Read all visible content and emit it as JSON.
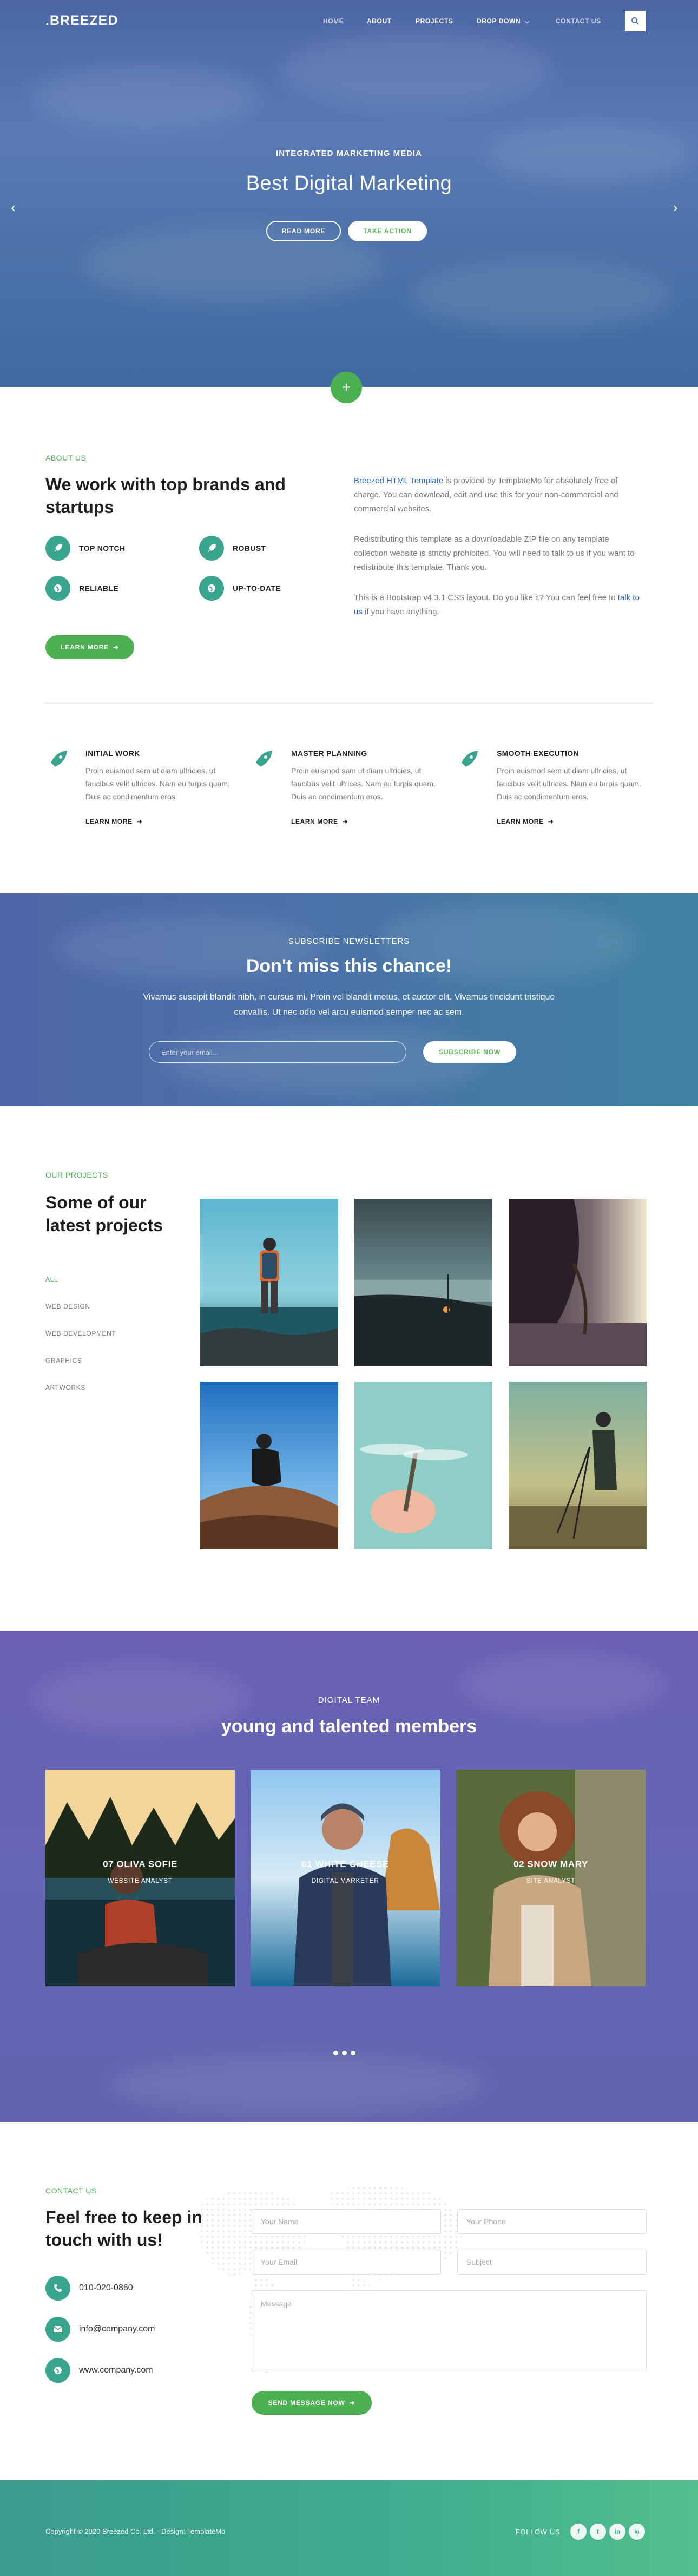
{
  "header": {
    "brand": ".BREEZED",
    "nav": [
      "HOME",
      "ABOUT",
      "PROJECTS",
      "DROP DOWN",
      "CONTACT US"
    ]
  },
  "hero": {
    "subtitle": "INTEGRATED MARKETING MEDIA",
    "title": "Best Digital Marketing",
    "read_more": "READ MORE",
    "take_action": "TAKE ACTION"
  },
  "about": {
    "label": "ABOUT US",
    "title": "We work with top brands and startups",
    "features": [
      "TOP NOTCH",
      "ROBUST",
      "RELIABLE",
      "UP-TO-DATE"
    ],
    "learn_more": "LEARN MORE",
    "p1_link": "Breezed HTML Template",
    "p1_text": " is provided by TemplateMo for absolutely free of charge. You can download, edit and use this for your non-commercial and commercial websites.",
    "p2": "Redistributing this template as a downloadable ZIP file on any template collection website is strictly prohibited. You will need to talk to us if you want to redistribute this template. Thank you.",
    "p3_text": "This is a Bootstrap v4.3.1 CSS layout. Do you like it? You can feel free to ",
    "p3_link": "talk to us",
    "p3_end": " if you have anything."
  },
  "services": [
    {
      "title": "INITIAL WORK",
      "text": "Proin euismod sem ut diam ultricies, ut faucibus velit ultrices. Nam eu turpis quam. Duis ac condimentum eros.",
      "more": "LEARN MORE"
    },
    {
      "title": "MASTER PLANNING",
      "text": "Proin euismod sem ut diam ultricies, ut faucibus velit ultrices. Nam eu turpis quam. Duis ac condimentum eros.",
      "more": "LEARN MORE"
    },
    {
      "title": "SMOOTH EXECUTION",
      "text": "Proin euismod sem ut diam ultricies, ut faucibus velit ultrices. Nam eu turpis quam. Duis ac condimentum eros.",
      "more": "LEARN MORE"
    }
  ],
  "subscribe": {
    "label": "SUBSCRIBE NEWSLETTERS",
    "title": "Don't miss this chance!",
    "text": "Vivamus suscipit blandit nibh, in cursus mi. Proin vel blandit metus, et auctor elit. Vivamus tincidunt tristique convallis. Ut nec odio vel arcu euismod semper nec ac sem.",
    "email_placeholder": "Enter your email...",
    "button": "SUBSCRIBE NOW"
  },
  "projects": {
    "label": "OUR PROJECTS",
    "title": "Some of our latest projects",
    "filters": [
      "ALL",
      "WEB DESIGN",
      "WEB DEVELOPMENT",
      "GRAPHICS",
      "ARTWORKS"
    ]
  },
  "team": {
    "label": "DIGITAL TEAM",
    "title": "young and talented members",
    "members": [
      {
        "name": "07 OLIVA SOFIE",
        "role": "WEBSITE ANALYST"
      },
      {
        "name": "01 WHITE CHEESE",
        "role": "DIGITAL MARKETER"
      },
      {
        "name": "02 SNOW MARY",
        "role": "SITE ANALYST"
      }
    ]
  },
  "contact": {
    "label": "CONTACT US",
    "title": "Feel free to keep in touch with us!",
    "phone": "010-020-0860",
    "email": "info@company.com",
    "website": "www.company.com",
    "name_placeholder": "Your Name",
    "phone_placeholder": "Your Phone",
    "email_placeholder": "Your Email",
    "subject_placeholder": "Subject",
    "message_placeholder": "Message",
    "send_button": "SEND MESSAGE NOW"
  },
  "footer": {
    "copyright": "Copyright © 2020 Breezed Co. Ltd. - Design: TemplateMo",
    "follow": "FOLLOW US",
    "social": [
      "f",
      "t",
      "in",
      "ig"
    ]
  },
  "colors": {
    "accent": "#4caf50",
    "teal": "#3aa58f",
    "link": "#2a63c8"
  }
}
